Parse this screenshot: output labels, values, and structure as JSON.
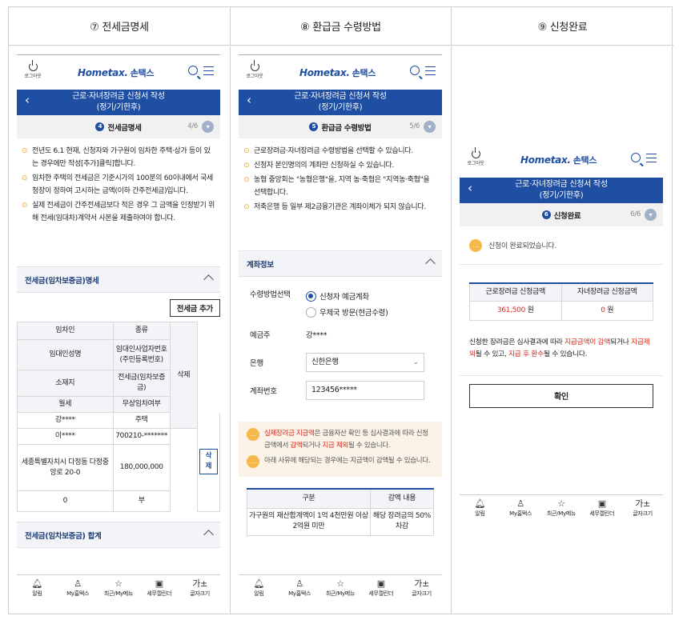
{
  "headers": [
    "⑦ 전세금명세",
    "⑧ 환급금 수령방법",
    "⑨ 신청완료"
  ],
  "common": {
    "logout": "로그아웃",
    "logo_home": "Hom",
    "logo_tax": "etax.",
    "logo_son": "손택스",
    "form_title": "근로·자녀장려금 신청서 작성",
    "form_sub": "(정기/기한후)",
    "tabs": [
      "알림",
      "My홈택스",
      "최근/My메뉴",
      "세무캘린더",
      "글자크기"
    ]
  },
  "p1": {
    "step_num": "4",
    "step": "전세금명세",
    "page": "4/6",
    "notes": [
      "전년도 6.1 현재, 신청자와 가구원이 임차한 주택·상가 등이 있는 경우에만 작성[추가]클릭]합니다.",
      "임차한 주택의 전세금은 기준시가의 100분의 60이내에서 국세청장이 정하여 고시하는 금액(이하 간주전세금)입니다.",
      "실제 전세금이 간주전세금보다 적은 경우 그 금액을 인정받기 위해 전세(임대차)계약서 사본을 제출하여야 합니다."
    ],
    "section": "전세금(임차보증금)명세",
    "add_btn": "전세금 추가",
    "th": [
      "임차인",
      "종류",
      "임대인성명",
      "임대인사업자번호\n(주민등록번호)",
      "삭제",
      "소재지",
      "전세금(임차보증금)",
      "월세",
      "무상임차여부"
    ],
    "row": {
      "tenant": "강****",
      "kind": "주택",
      "landlord": "이****",
      "landlord_no": "700210-*******",
      "addr": "세종특별자치시 다정동 다정중앙로 20-0",
      "deposit": "180,000,000",
      "del": "삭제",
      "rent": "0",
      "free": "부"
    },
    "total": "전세금(임차보증금) 합계"
  },
  "p2": {
    "step_num": "5",
    "step": "환급금 수령방법",
    "page": "5/6",
    "notes": [
      "근로장려금·자녀장려금 수령방법을 선택할 수 있습니다.",
      "신청자 본인명의의 계좌만 신청하실 수 있습니다.",
      "농협 중앙회는 \"농협은행\"을, 지역 농·축협은 \"지역농·축협\"을 선택합니다.",
      "저축은행 등 일부 제2금융기관은 계좌이체가 되지 않습니다."
    ],
    "section": "계좌정보",
    "method_label": "수령방법선택",
    "opt1": "신청자 예금계좌",
    "opt2": "우체국 방문(현금수령)",
    "owner_label": "예금주",
    "owner": "강****",
    "bank_label": "은행",
    "bank": "신한은행",
    "acct_label": "계좌번호",
    "acct": "123456*****",
    "info1_red": "실제장려금 지급액",
    "info1_a": "은 금융자산 확인 등 심사결과에 따라 신청금액에서 ",
    "info1_red2": "감액",
    "info1_b": "되거나 ",
    "info1_red3": "지급 제외",
    "info1_c": "될 수 있습니다.",
    "info2": "아래 사유에 해당되는 경우에는 지급액이 감액될 수 있습니다.",
    "th1": "구분",
    "th2": "감액 내용",
    "td1": "가구원의 재산합계액이 1억 4천만원 이상 2억원 미만",
    "td2": "해당 장려금의 50% 차감"
  },
  "p3": {
    "step_num": "6",
    "step": "신청완료",
    "page": "6/6",
    "done": "신청이 완료되었습니다.",
    "th1": "근로장려금 신청금액",
    "th2": "자녀장려금 신청금액",
    "v1": "361,500",
    "v2": "0",
    "won": "원",
    "msg_a": "신청한 장려금은 심사결과에 따라 ",
    "msg_r1": "지급금액이 감액",
    "msg_b": "되거나 ",
    "msg_r2": "지급제외",
    "msg_c": "될 수 있고, ",
    "msg_r3": "지급 후 환수",
    "msg_d": "될 수 있습니다.",
    "confirm": "확인"
  },
  "colors": {
    "brand": "#1e4fa3",
    "accent": "#d6291c",
    "note_icon": "#f0a020"
  }
}
